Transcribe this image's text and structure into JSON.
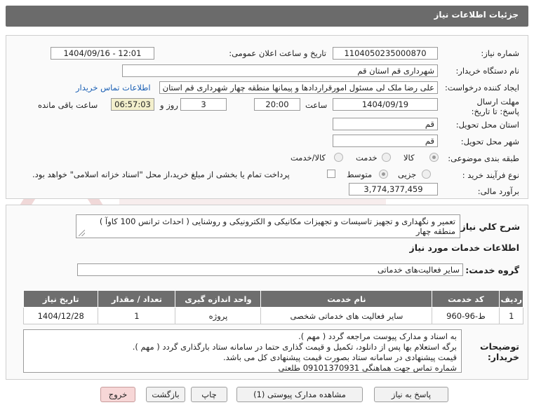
{
  "header": {
    "title": "جزئیات اطلاعات نیاز"
  },
  "form": {
    "need_number_label": "شماره نیاز:",
    "need_number": "1104050235000870",
    "announce_label": "تاریخ و ساعت اعلان عمومی:",
    "announce_value": "1404/09/16 - 12:01",
    "buyer_org_label": "نام دستگاه خریدار:",
    "buyer_org": "شهرداری قم استان قم",
    "creator_label": "ایجاد کننده درخواست:",
    "creator": "علی رضا ملک لی مسئول امورقراردادها و پیمانها منطقه چهار  شهرداری قم استان قم",
    "contact_link": "اطلاعات تماس خریدار",
    "deadline_label": "مهلت ارسال پاسخ: تا تاریخ:",
    "deadline_date": "1404/09/19",
    "time_label": "ساعت",
    "deadline_time": "20:00",
    "days": "3",
    "days_label": "روز و",
    "remaining_time": "06:57:03",
    "remaining_label": "ساعت باقی مانده",
    "province_label": "استان محل تحویل:",
    "province": "قم",
    "city_label": "شهر محل تحویل:",
    "city": "قم",
    "category_label": "طبقه بندی موضوعی:",
    "category_options": [
      "کالا",
      "خدمت",
      "کالا/خدمت"
    ],
    "process_label": "نوع فرآیند خرید :",
    "process_options": [
      "جزیی",
      "متوسط"
    ],
    "payment_note": "پرداخت تمام یا بخشی از مبلغ خرید،از محل \"اسناد خزانه اسلامی\" خواهد بود.",
    "estimate_label": "برآورد مالی:",
    "estimate": "3,774,377,459"
  },
  "summary": {
    "label": "شرح کلي نياز:",
    "text": "تعمیر و نگهداری و تجهیز تاسیسات و تجهیزات مکانیکی و الکترونیکی و روشنایی ( احداث ترانس 100 کاوآ ) منطقه چهار"
  },
  "services": {
    "section_title": "اطلاعات خدمات مورد نیاز",
    "group_label": "گروه خدمت:",
    "group_value": "سایر فعالیت‌های خدماتی",
    "table": {
      "headers": [
        "ردیف",
        "کد خدمت",
        "نام خدمت",
        "واحد اندازه گیری",
        "تعداد / مقدار",
        "تاریخ نیاز"
      ],
      "rows": [
        [
          "1",
          "ط-96-960",
          "سایر فعالیت های خدماتی شخصی",
          "پروژه",
          "1",
          "1404/12/28"
        ]
      ]
    }
  },
  "buyer_notes": {
    "label": "توضیحات خریدار:",
    "lines": [
      "به اسناد و مدارک پیوست مراجعه گردد ( مهم ).",
      "برگه استعلام بها پس از دانلود، تکمیل و قیمت گذاری حتما در سامانه ستاد بارگذاری گردد ( مهم ).",
      "قیمت پیشنهادی در سامانه ستاد بصورت قیمت پیشنهادی کل  می باشد.",
      "شماره تماس جهت هماهنگی 09101370931 طلعتی"
    ]
  },
  "buttons": {
    "reply": "پاسخ به نیاز",
    "attachments": "مشاهده مدارک پیوستی (1)",
    "print": "چاپ",
    "back": "بازگشت",
    "exit": "خروج"
  },
  "colors": {
    "header_bg": "#6b6b6b",
    "link": "#1a5fb4",
    "remaining_bg": "#f3efcc",
    "exit_bg": "#f7d7d7"
  }
}
